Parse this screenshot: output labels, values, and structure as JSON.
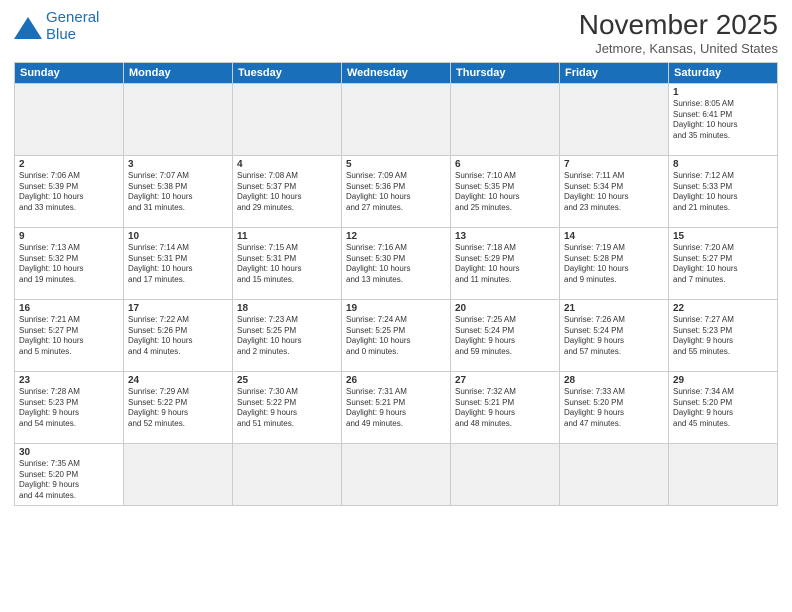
{
  "header": {
    "logo_line1": "General",
    "logo_line2": "Blue",
    "title": "November 2025",
    "subtitle": "Jetmore, Kansas, United States"
  },
  "weekdays": [
    "Sunday",
    "Monday",
    "Tuesday",
    "Wednesday",
    "Thursday",
    "Friday",
    "Saturday"
  ],
  "weeks": [
    [
      {
        "day": "",
        "info": "",
        "empty": true
      },
      {
        "day": "",
        "info": "",
        "empty": true
      },
      {
        "day": "",
        "info": "",
        "empty": true
      },
      {
        "day": "",
        "info": "",
        "empty": true
      },
      {
        "day": "",
        "info": "",
        "empty": true
      },
      {
        "day": "",
        "info": "",
        "empty": true
      },
      {
        "day": "1",
        "info": "Sunrise: 8:05 AM\nSunset: 6:41 PM\nDaylight: 10 hours\nand 35 minutes."
      }
    ],
    [
      {
        "day": "2",
        "info": "Sunrise: 7:06 AM\nSunset: 5:39 PM\nDaylight: 10 hours\nand 33 minutes."
      },
      {
        "day": "3",
        "info": "Sunrise: 7:07 AM\nSunset: 5:38 PM\nDaylight: 10 hours\nand 31 minutes."
      },
      {
        "day": "4",
        "info": "Sunrise: 7:08 AM\nSunset: 5:37 PM\nDaylight: 10 hours\nand 29 minutes."
      },
      {
        "day": "5",
        "info": "Sunrise: 7:09 AM\nSunset: 5:36 PM\nDaylight: 10 hours\nand 27 minutes."
      },
      {
        "day": "6",
        "info": "Sunrise: 7:10 AM\nSunset: 5:35 PM\nDaylight: 10 hours\nand 25 minutes."
      },
      {
        "day": "7",
        "info": "Sunrise: 7:11 AM\nSunset: 5:34 PM\nDaylight: 10 hours\nand 23 minutes."
      },
      {
        "day": "8",
        "info": "Sunrise: 7:12 AM\nSunset: 5:33 PM\nDaylight: 10 hours\nand 21 minutes."
      }
    ],
    [
      {
        "day": "9",
        "info": "Sunrise: 7:13 AM\nSunset: 5:32 PM\nDaylight: 10 hours\nand 19 minutes."
      },
      {
        "day": "10",
        "info": "Sunrise: 7:14 AM\nSunset: 5:31 PM\nDaylight: 10 hours\nand 17 minutes."
      },
      {
        "day": "11",
        "info": "Sunrise: 7:15 AM\nSunset: 5:31 PM\nDaylight: 10 hours\nand 15 minutes."
      },
      {
        "day": "12",
        "info": "Sunrise: 7:16 AM\nSunset: 5:30 PM\nDaylight: 10 hours\nand 13 minutes."
      },
      {
        "day": "13",
        "info": "Sunrise: 7:18 AM\nSunset: 5:29 PM\nDaylight: 10 hours\nand 11 minutes."
      },
      {
        "day": "14",
        "info": "Sunrise: 7:19 AM\nSunset: 5:28 PM\nDaylight: 10 hours\nand 9 minutes."
      },
      {
        "day": "15",
        "info": "Sunrise: 7:20 AM\nSunset: 5:27 PM\nDaylight: 10 hours\nand 7 minutes."
      }
    ],
    [
      {
        "day": "16",
        "info": "Sunrise: 7:21 AM\nSunset: 5:27 PM\nDaylight: 10 hours\nand 5 minutes."
      },
      {
        "day": "17",
        "info": "Sunrise: 7:22 AM\nSunset: 5:26 PM\nDaylight: 10 hours\nand 4 minutes."
      },
      {
        "day": "18",
        "info": "Sunrise: 7:23 AM\nSunset: 5:25 PM\nDaylight: 10 hours\nand 2 minutes."
      },
      {
        "day": "19",
        "info": "Sunrise: 7:24 AM\nSunset: 5:25 PM\nDaylight: 10 hours\nand 0 minutes."
      },
      {
        "day": "20",
        "info": "Sunrise: 7:25 AM\nSunset: 5:24 PM\nDaylight: 9 hours\nand 59 minutes."
      },
      {
        "day": "21",
        "info": "Sunrise: 7:26 AM\nSunset: 5:24 PM\nDaylight: 9 hours\nand 57 minutes."
      },
      {
        "day": "22",
        "info": "Sunrise: 7:27 AM\nSunset: 5:23 PM\nDaylight: 9 hours\nand 55 minutes."
      }
    ],
    [
      {
        "day": "23",
        "info": "Sunrise: 7:28 AM\nSunset: 5:23 PM\nDaylight: 9 hours\nand 54 minutes."
      },
      {
        "day": "24",
        "info": "Sunrise: 7:29 AM\nSunset: 5:22 PM\nDaylight: 9 hours\nand 52 minutes."
      },
      {
        "day": "25",
        "info": "Sunrise: 7:30 AM\nSunset: 5:22 PM\nDaylight: 9 hours\nand 51 minutes."
      },
      {
        "day": "26",
        "info": "Sunrise: 7:31 AM\nSunset: 5:21 PM\nDaylight: 9 hours\nand 49 minutes."
      },
      {
        "day": "27",
        "info": "Sunrise: 7:32 AM\nSunset: 5:21 PM\nDaylight: 9 hours\nand 48 minutes."
      },
      {
        "day": "28",
        "info": "Sunrise: 7:33 AM\nSunset: 5:20 PM\nDaylight: 9 hours\nand 47 minutes."
      },
      {
        "day": "29",
        "info": "Sunrise: 7:34 AM\nSunset: 5:20 PM\nDaylight: 9 hours\nand 45 minutes."
      }
    ],
    [
      {
        "day": "30",
        "info": "Sunrise: 7:35 AM\nSunset: 5:20 PM\nDaylight: 9 hours\nand 44 minutes.",
        "last": true
      },
      {
        "day": "",
        "info": "",
        "empty": true,
        "last": true
      },
      {
        "day": "",
        "info": "",
        "empty": true,
        "last": true
      },
      {
        "day": "",
        "info": "",
        "empty": true,
        "last": true
      },
      {
        "day": "",
        "info": "",
        "empty": true,
        "last": true
      },
      {
        "day": "",
        "info": "",
        "empty": true,
        "last": true
      },
      {
        "day": "",
        "info": "",
        "empty": true,
        "last": true
      }
    ]
  ]
}
